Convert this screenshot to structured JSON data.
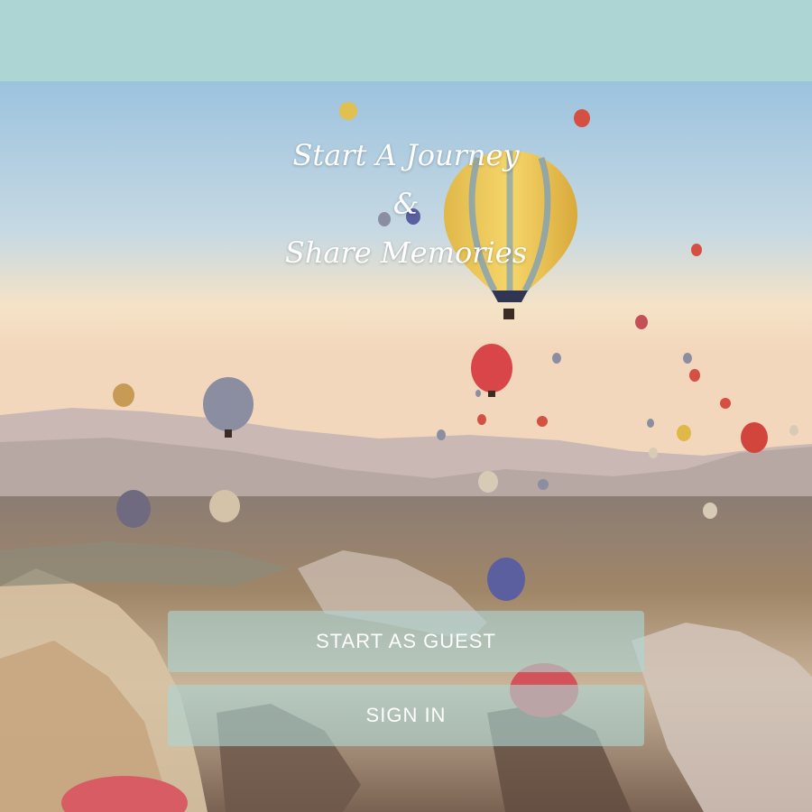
{
  "header": {
    "color": "#acd5d3"
  },
  "hero": {
    "tagline_line1": "Start A Journey",
    "tagline_line2": "&",
    "tagline_line3": "Share Memories",
    "image_subject": "hot-air-balloons-over-valley"
  },
  "actions": {
    "guest_label": "START AS GUEST",
    "signin_label": "SIGN IN"
  },
  "colors": {
    "accent": "#acd5d3",
    "button_text": "#ffffff"
  }
}
